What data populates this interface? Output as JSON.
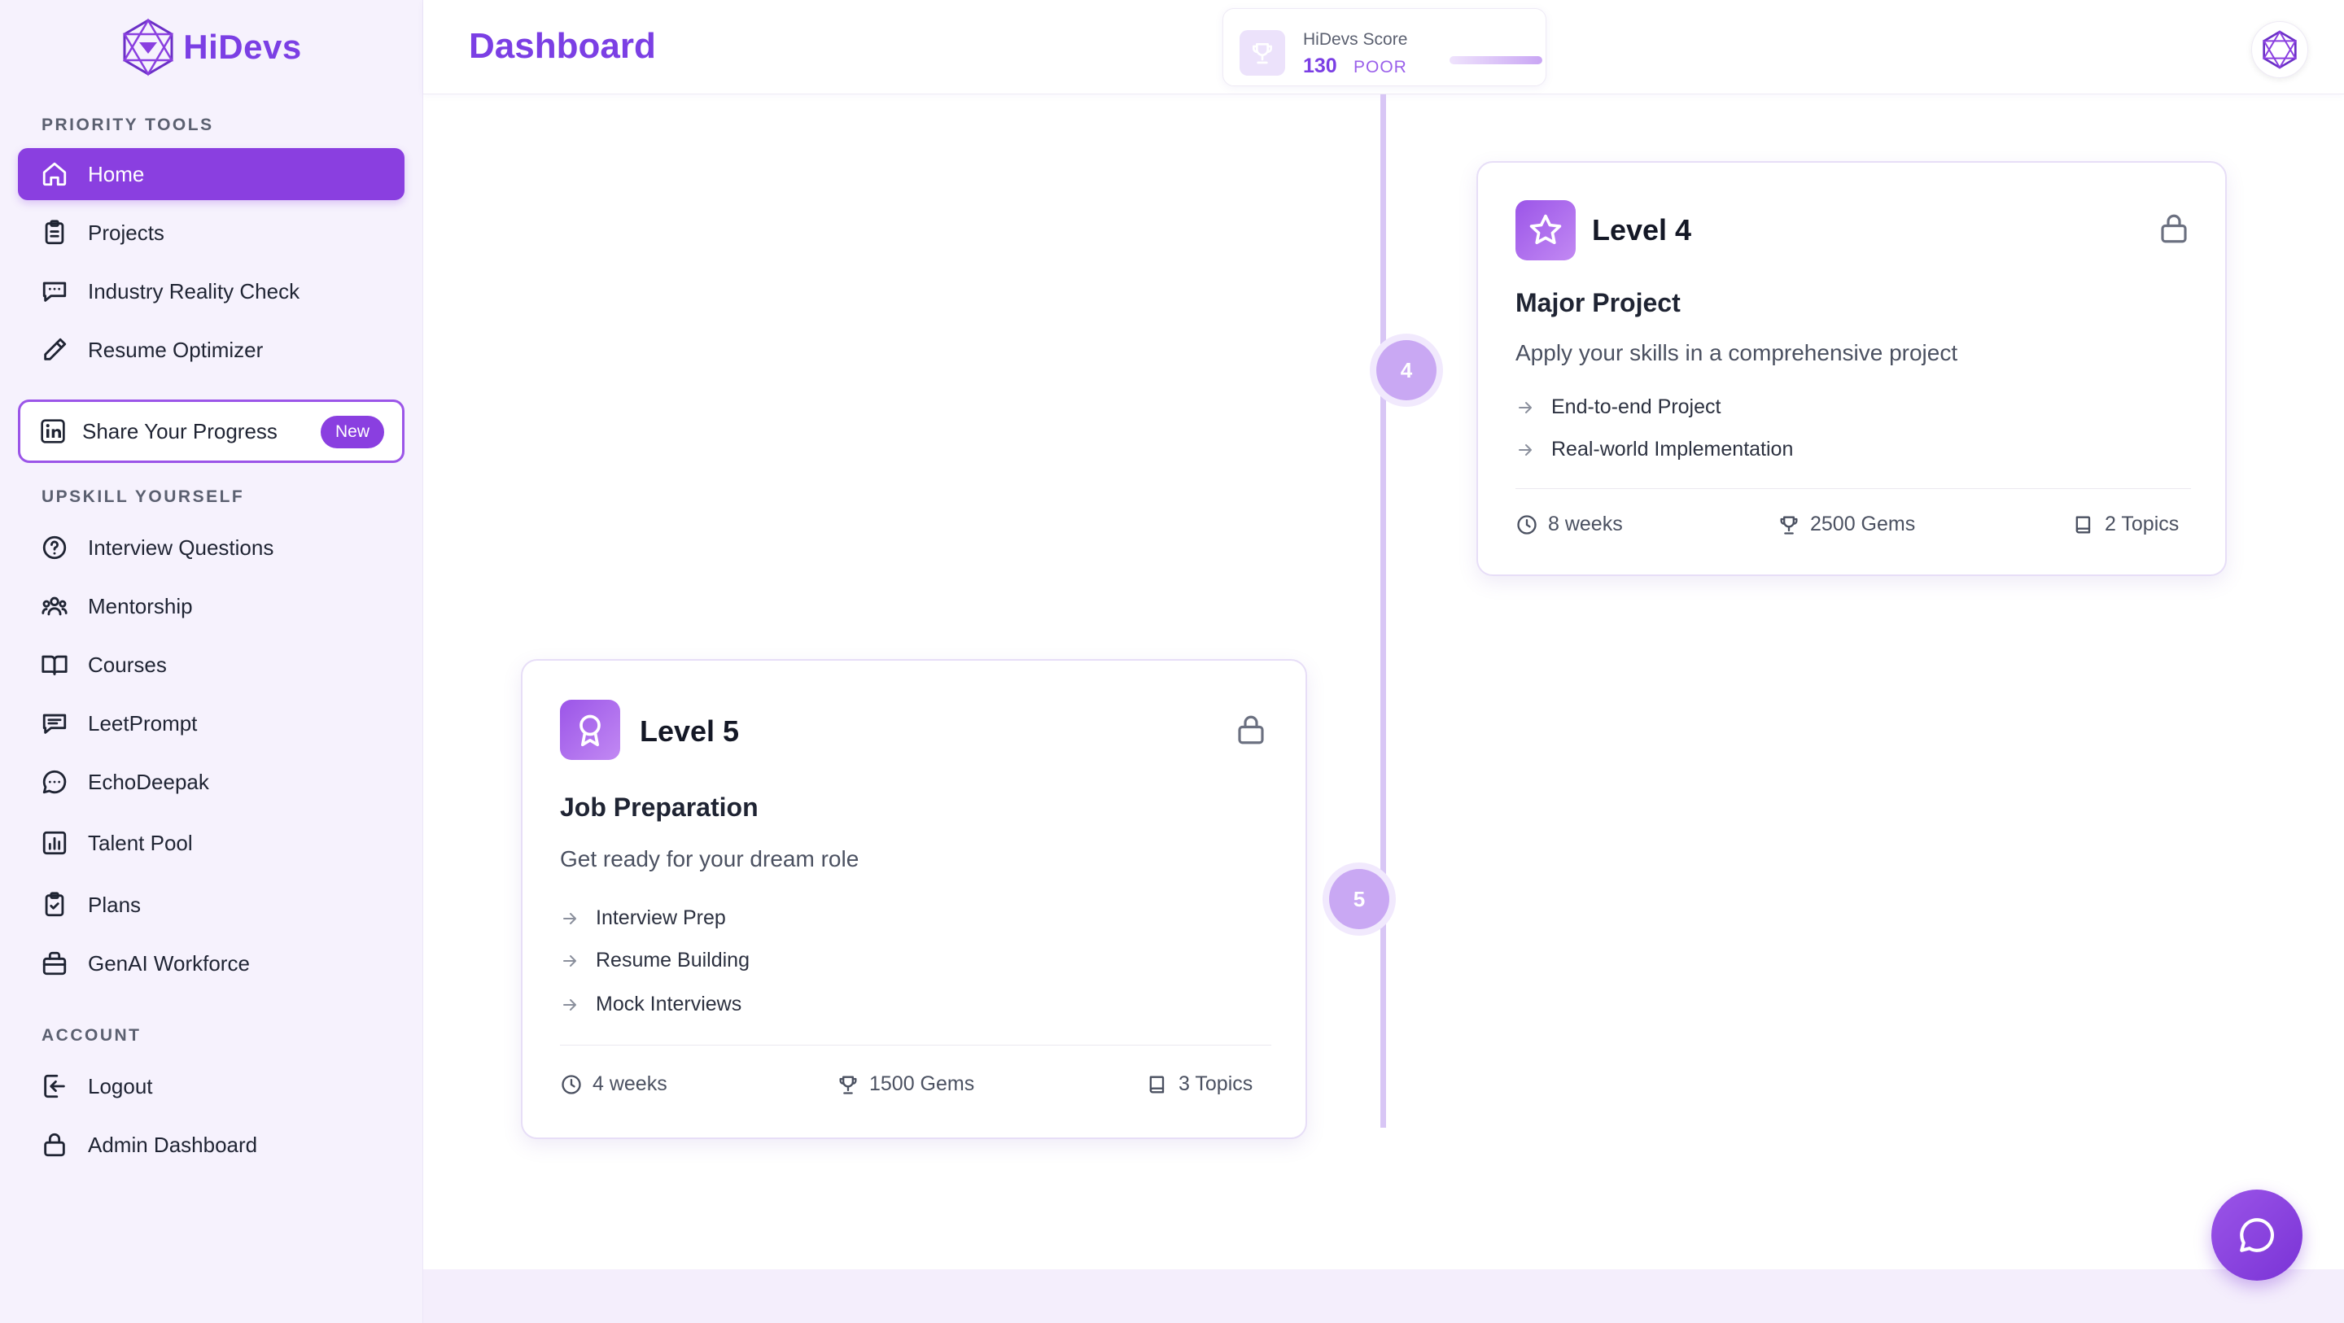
{
  "brand": {
    "name": "HiDevs"
  },
  "sidebar": {
    "sections": [
      {
        "title": "PRIORITY TOOLS"
      },
      {
        "title": "UPSKILL YOURSELF"
      },
      {
        "title": "ACCOUNT"
      }
    ],
    "priority": [
      {
        "label": "Home",
        "icon": "home-icon",
        "active": true
      },
      {
        "label": "Projects",
        "icon": "clipboard-icon"
      },
      {
        "label": "Industry Reality Check",
        "icon": "message-square-icon"
      },
      {
        "label": "Resume Optimizer",
        "icon": "pencil-icon"
      }
    ],
    "share": {
      "label": "Share Your Progress",
      "badge": "New",
      "icon": "linkedin-icon"
    },
    "upskill": [
      {
        "label": "Interview Questions",
        "icon": "help-circle-icon"
      },
      {
        "label": "Mentorship",
        "icon": "users-icon"
      },
      {
        "label": "Courses",
        "icon": "book-open-icon"
      },
      {
        "label": "LeetPrompt",
        "icon": "message-lines-icon"
      },
      {
        "label": "EchoDeepak",
        "icon": "chat-bubble-icon"
      },
      {
        "label": "Talent Pool",
        "icon": "bar-chart-icon"
      },
      {
        "label": "Plans",
        "icon": "clipboard-check-icon"
      },
      {
        "label": "GenAI Workforce",
        "icon": "briefcase-icon"
      }
    ],
    "account": [
      {
        "label": "Logout",
        "icon": "logout-icon"
      },
      {
        "label": "Admin Dashboard",
        "icon": "lock-icon"
      }
    ]
  },
  "header": {
    "title": "Dashboard",
    "score": {
      "label": "HiDevs Score",
      "value": "130",
      "status": "POOR",
      "progress": 0.13
    }
  },
  "timeline": {
    "dots": [
      "4",
      "5"
    ]
  },
  "cards": [
    {
      "level": "Level 4",
      "heading": "Major Project",
      "description": "Apply your skills in a comprehensive project",
      "features": [
        "End-to-end Project",
        "Real-world Implementation"
      ],
      "duration": "8 weeks",
      "gems": "2500 Gems",
      "topics": "2 Topics",
      "icon": "star-icon"
    },
    {
      "level": "Level 5",
      "heading": "Job Preparation",
      "description": "Get ready for your dream role",
      "features": [
        "Interview Prep",
        "Resume Building",
        "Mock Interviews"
      ],
      "duration": "4 weeks",
      "gems": "1500 Gems",
      "topics": "3 Topics",
      "icon": "award-icon"
    }
  ],
  "colors": {
    "accent": "#8a3fe0",
    "brand": "#7b3fe4",
    "sidebar_bg": "#f6f2fd",
    "timeline": "#d8c6f5"
  }
}
